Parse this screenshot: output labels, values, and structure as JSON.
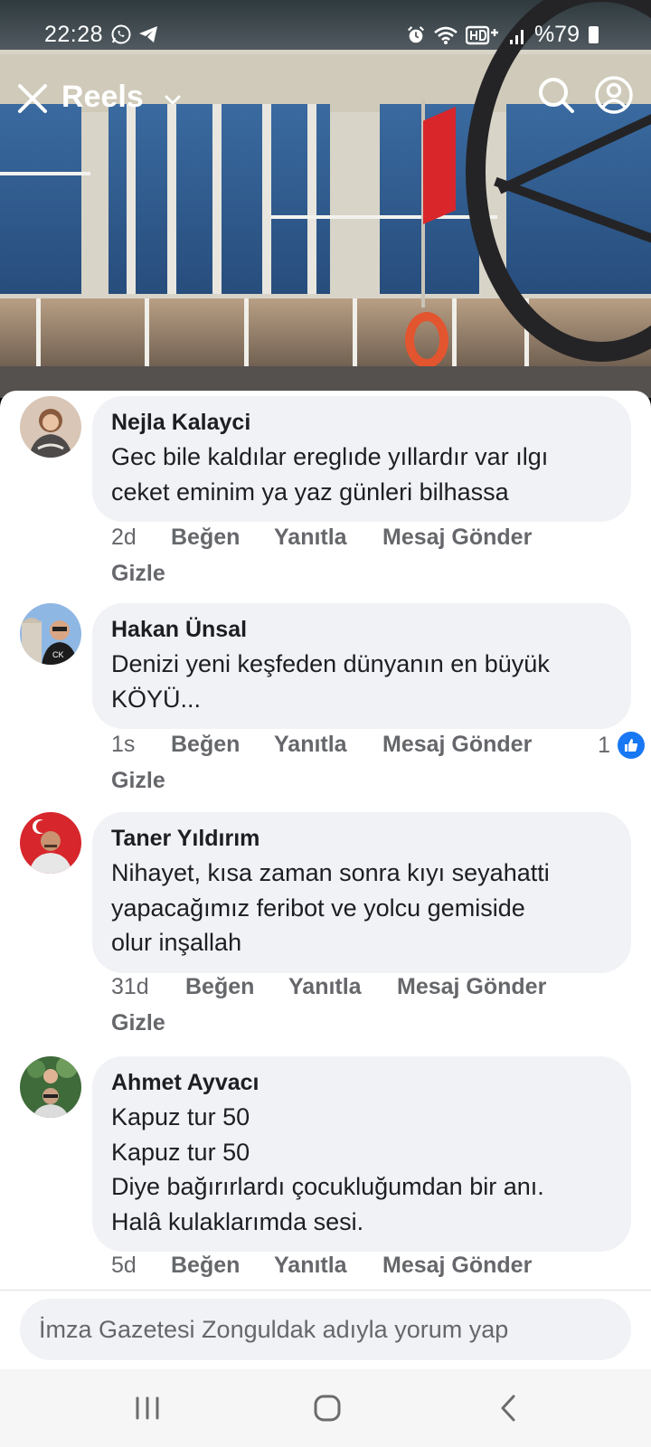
{
  "status_bar": {
    "time": "22:28",
    "left_icons": [
      "whatsapp-icon",
      "telegram-icon"
    ],
    "right_icons": [
      "alarm-icon",
      "wifi-icon",
      "hd-voice-icon",
      "signal-icon"
    ],
    "battery": "%79"
  },
  "top_bar": {
    "title": "Reels",
    "icons": [
      "close-icon",
      "chevron-down-icon",
      "search-icon",
      "profile-icon"
    ]
  },
  "comments": [
    {
      "author": "Nejla Kalayci",
      "lines": [
        "Gec bile kaldılar  ereglıde yıllardır var ılgı",
        "ceket eminim ya yaz günleri bilhassa"
      ],
      "time": "2d",
      "like_label": "Beğen",
      "reply_label": "Yanıtla",
      "message_label": "Mesaj Gönder",
      "hide_label": "Gizle"
    },
    {
      "author": "Hakan Ünsal",
      "lines": [
        "Denizi yeni keşfeden dünyanın en büyük",
        "KÖYÜ..."
      ],
      "time": "1s",
      "like_label": "Beğen",
      "reply_label": "Yanıtla",
      "message_label": "Mesaj Gönder",
      "hide_label": "Gizle",
      "reaction_count": "1"
    },
    {
      "author": "Taner Yıldırım",
      "lines": [
        "Nihayet,  kısa zaman sonra kıyı seyahatti",
        "yapacağımız feribot ve yolcu gemiside",
        "olur inşallah"
      ],
      "time": "31d",
      "like_label": "Beğen",
      "reply_label": "Yanıtla",
      "message_label": "Mesaj Gönder",
      "hide_label": "Gizle"
    },
    {
      "author": "Ahmet Ayvacı",
      "lines": [
        "Kapuz tur 50",
        "Kapuz tur 50",
        "Diye bağırırlardı çocukluğumdan bir anı.",
        "Halâ kulaklarımda sesi."
      ],
      "time": "5d",
      "like_label": "Beğen",
      "reply_label": "Yanıtla",
      "message_label": "Mesaj Gönder"
    }
  ],
  "composer": {
    "placeholder": "İmza Gazetesi Zonguldak adıyla yorum yap"
  },
  "nav_bar": {
    "icons": [
      "recent-apps-icon",
      "home-icon",
      "back-icon"
    ]
  },
  "colors": {
    "bubble": "#f0f2f5",
    "meta_text": "#65676b",
    "body_text": "#1c1e21",
    "like_blue": "#1877f2"
  }
}
